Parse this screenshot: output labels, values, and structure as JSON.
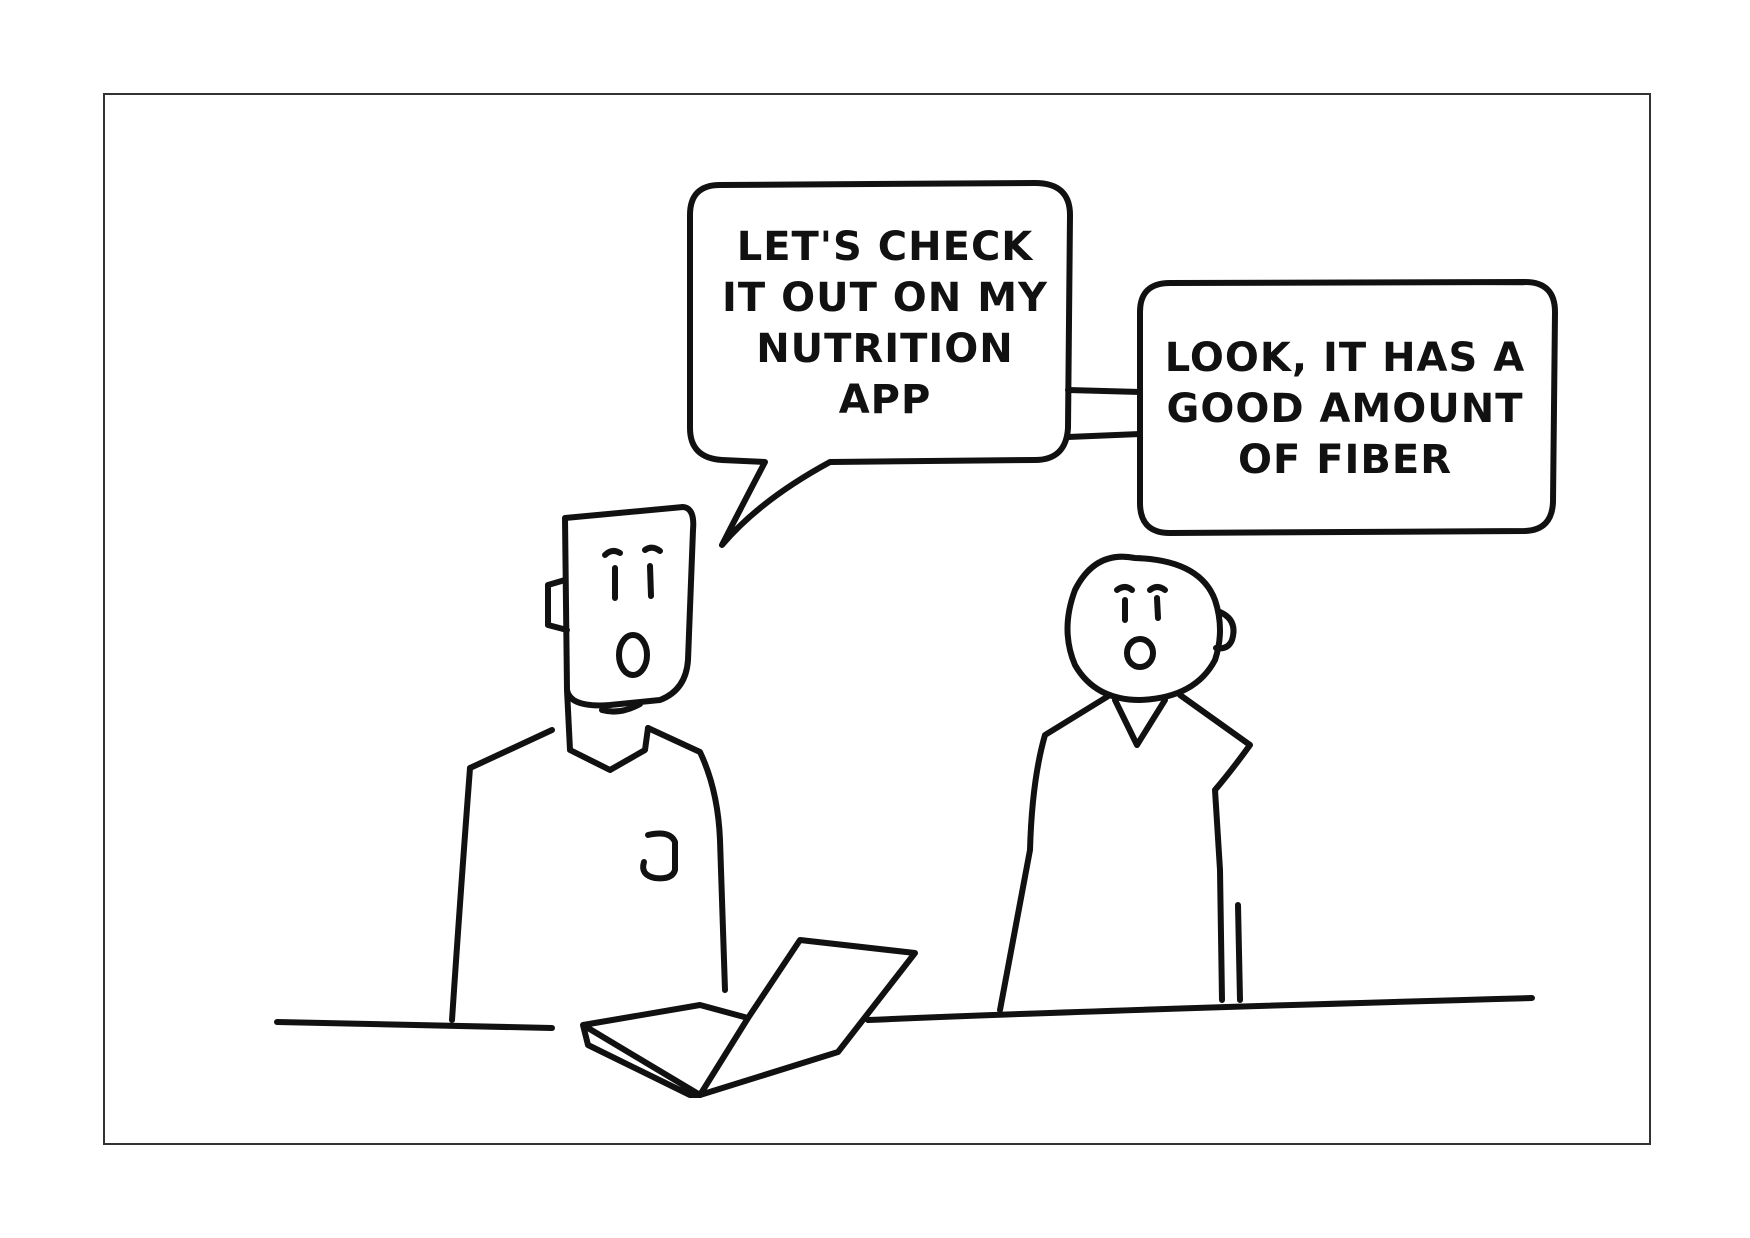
{
  "speech_bubbles": {
    "left": {
      "lines": [
        "LET'S CHECK",
        "IT OUT ON MY",
        "NUTRITION",
        "APP"
      ]
    },
    "right": {
      "lines": [
        "LOOK, IT HAS A",
        "GOOD AMOUNT",
        "OF FIBER"
      ]
    }
  },
  "colors": {
    "ink": "#111111",
    "frame": "#333333",
    "background": "#ffffff"
  }
}
